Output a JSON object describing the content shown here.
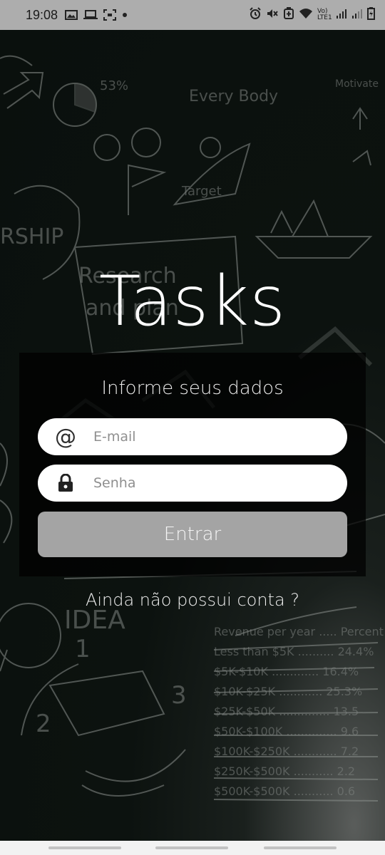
{
  "status_bar": {
    "time": "19:08",
    "network_label": "Vo) LTE1"
  },
  "app": {
    "title": "Tasks",
    "subtitle": "Informe seus dados"
  },
  "form": {
    "email": {
      "placeholder": "E-mail",
      "value": "",
      "icon": "at-icon"
    },
    "password": {
      "placeholder": "Senha",
      "value": "",
      "icon": "lock-icon"
    },
    "submit_label": "Entrar"
  },
  "signup_link": "Ainda não possui conta ?",
  "colors": {
    "status_bar": "#adadad",
    "background": "#0c120f",
    "button": "#a4a4a4",
    "text": "#ffffff"
  }
}
